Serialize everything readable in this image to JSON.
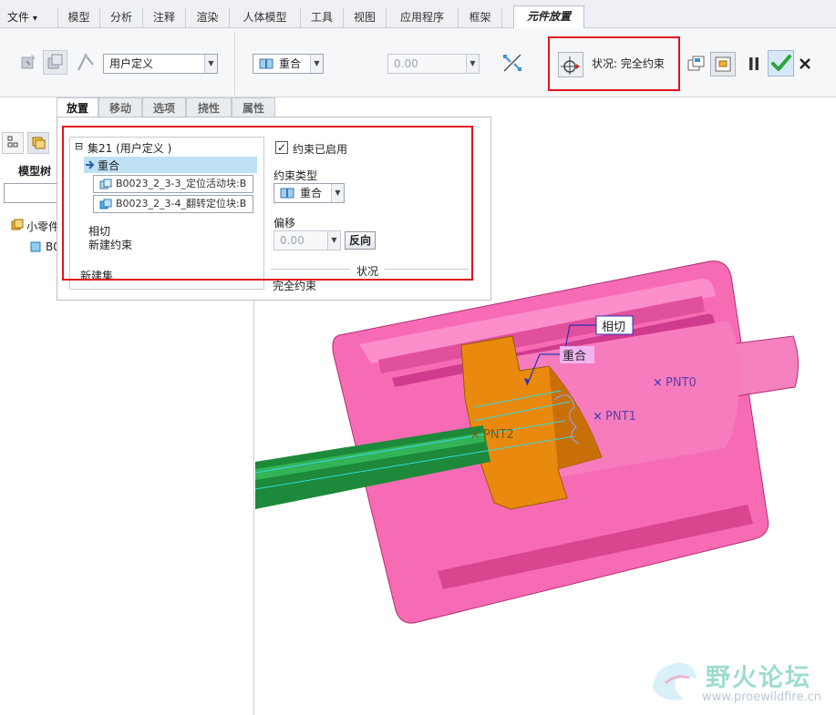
{
  "menubar": {
    "file_label": "文件",
    "file_arrow": "▾",
    "tabs": [
      "模型",
      "分析",
      "注释",
      "渲染",
      "人体模型",
      "工具",
      "视图",
      "应用程序",
      "框架"
    ],
    "active_tab": "元件放置"
  },
  "ribbon": {
    "constraint_set": "用户定义",
    "constraint_type": "重合",
    "offset_value": "0.00",
    "status": "状况: 完全约束"
  },
  "subtabs": [
    "放置",
    "移动",
    "选项",
    "挠性",
    "属性"
  ],
  "placement": {
    "set_name": "集21 (用户定义 )",
    "tree_expand": "⊟",
    "selected_constraint": "重合",
    "refs": [
      "B0023_2_3-3_定位活动块:B",
      "B0023_2_3-4_翻转定位块:B"
    ],
    "other_constraint": "相切",
    "new_constraint": "新建约束",
    "new_set": "新建集",
    "enabled_label": "约束已启用",
    "checkmark": "✓",
    "type_label": "约束类型",
    "type_value": "重合",
    "offset_label": "偏移",
    "offset_value": "0.00",
    "flip_button": "反向",
    "status_title": "状况",
    "status_value": "完全约束"
  },
  "tree": {
    "title": "模型树",
    "root": "小零件",
    "child": "B0"
  },
  "viewport": {
    "annotations": {
      "tangent": "相切",
      "coincident": "重合"
    },
    "points": [
      "PNT0",
      "PNT1",
      "PNT2"
    ]
  },
  "watermark": {
    "cn": "野火论坛",
    "url": "www.proewildfire.cn"
  },
  "colors": {
    "pink": "#f76bb5",
    "orange": "#e98a0f",
    "green": "#1c8a3a",
    "status_red": "#e0141e",
    "ok_green": "#2fa33a"
  }
}
